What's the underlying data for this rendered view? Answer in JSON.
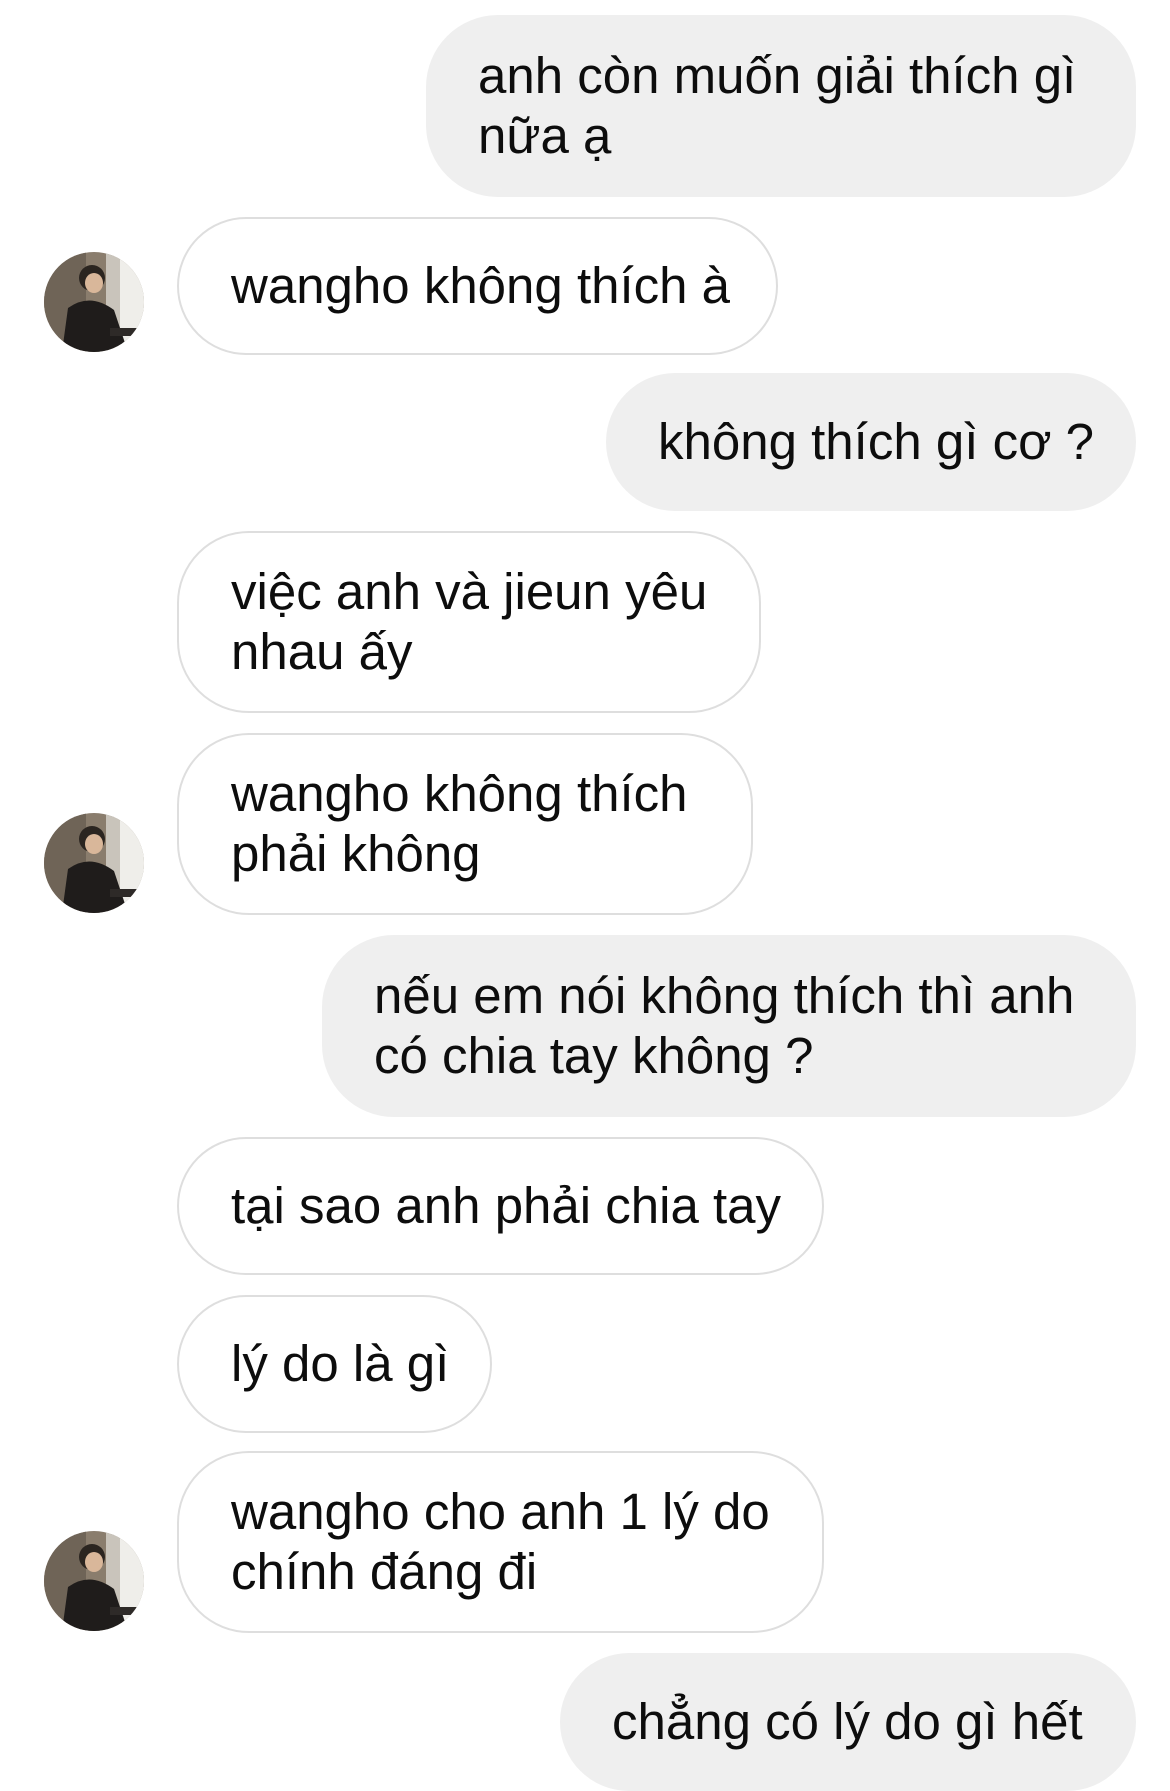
{
  "conversation": {
    "messages": [
      {
        "direction": "sent",
        "line1": "anh còn muốn giải thích gì",
        "line2": "nữa ạ"
      },
      {
        "direction": "received",
        "line1": "wangho không thích à",
        "line2": ""
      },
      {
        "direction": "sent",
        "line1": "không thích gì cơ ?",
        "line2": ""
      },
      {
        "direction": "received",
        "line1": "việc anh và jieun yêu",
        "line2": "nhau ấy"
      },
      {
        "direction": "received",
        "line1": "wangho không thích",
        "line2": "phải không"
      },
      {
        "direction": "sent",
        "line1": "nếu em nói không thích thì anh",
        "line2": "có chia tay không ?"
      },
      {
        "direction": "received",
        "line1": "tại sao anh phải chia tay",
        "line2": ""
      },
      {
        "direction": "received",
        "line1": "lý do là gì",
        "line2": ""
      },
      {
        "direction": "received",
        "line1": "wangho cho anh 1 lý do",
        "line2": "chính đáng đi"
      },
      {
        "direction": "sent",
        "line1": "chẳng có lý do gì hết",
        "line2": ""
      }
    ]
  },
  "colors": {
    "sent_bubble": "#efefef",
    "received_bubble": "#ffffff",
    "received_border": "#dedede",
    "text": "#0d0d0d"
  },
  "icons": {
    "avatar": "contact-avatar-photo"
  }
}
